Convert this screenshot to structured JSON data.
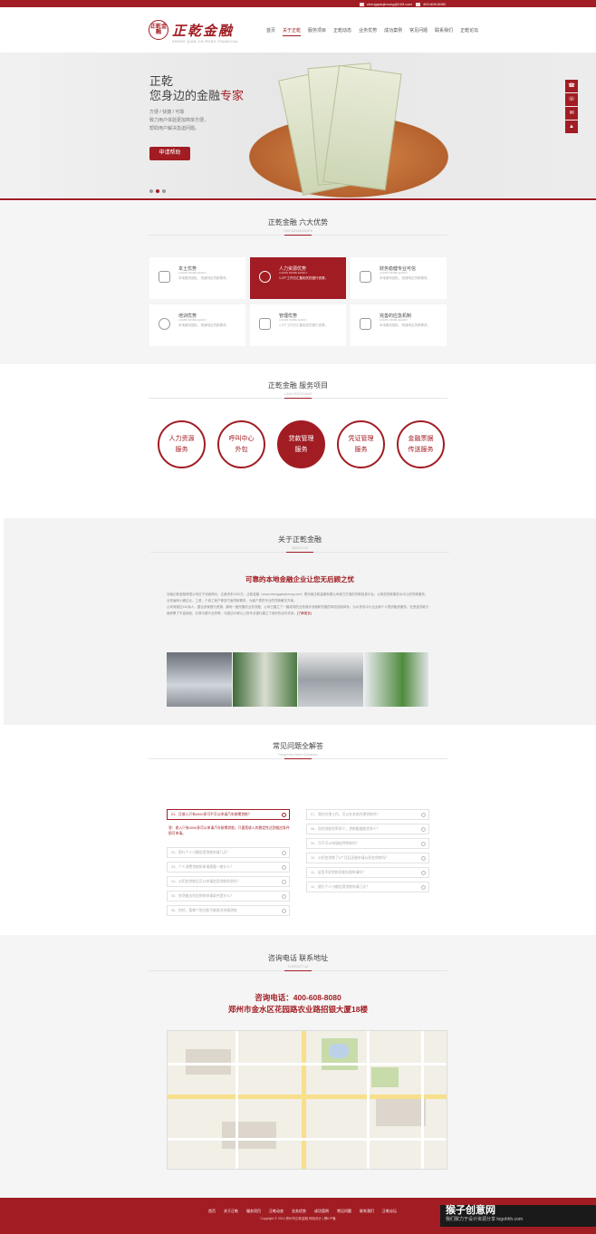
{
  "topbar": {
    "email": "zhengqianjinrong@163.com",
    "phone": "400-608-8080"
  },
  "logo": {
    "seal": "正乾金融",
    "name": "正乾金融",
    "sub": "ZHENG QIAN JIN RONG FINANCIAL"
  },
  "nav": [
    "首页",
    "关于正乾",
    "服务项目",
    "正乾动态",
    "业务优势",
    "成功案例",
    "常见问题",
    "联系我们",
    "正乾论坛"
  ],
  "hero": {
    "line1": "正乾",
    "line2_pre": "您身边的金融",
    "line2_em": "专家",
    "sub1": "方便 / 快捷 / 可靠",
    "sub2": "致力用户体验更加简单方便，",
    "sub3": "帮助用户解决急迫问题。",
    "button": "申请帮助"
  },
  "side": [
    "☎",
    "☏",
    "✉",
    "▲"
  ],
  "advantages": {
    "title": "正乾金融  六大优势",
    "en": "OUR ADVANTAGES",
    "cards": [
      {
        "t": "本土优势",
        "e": "LOANS MORE EASILY",
        "d": "本地服务团队，快速响应贷款需求。"
      },
      {
        "t": "人力资源优势",
        "e": "LOANS MORE EASILY",
        "d": "1-3个工作日汇集相关的银行资源，"
      },
      {
        "t": "财务稳健专业可信",
        "e": "LOANS MORE EASILY",
        "d": "本地服务团队，快速响应贷款需求。"
      },
      {
        "t": "培训优势",
        "e": "LOANS MORE EASILY",
        "d": "本地服务团队，快速响应贷款需求。"
      },
      {
        "t": "管理优势",
        "e": "LOANS MORE EASILY",
        "d": "1-3个工作日汇集相关的银行资源，"
      },
      {
        "t": "完善的应急机制",
        "e": "LOANS MORE EASILY",
        "d": "本地服务团队，快速响应贷款需求。"
      }
    ]
  },
  "services": {
    "title": "正乾金融  服务项目",
    "en": "LOAN PROGRAMS",
    "items": [
      {
        "l1": "人力资源",
        "l2": "服务"
      },
      {
        "l1": "呼叫中心",
        "l2": "外包"
      },
      {
        "l1": "贷款管理",
        "l2": "服务"
      },
      {
        "l1": "凭证管理",
        "l2": "服务"
      },
      {
        "l1": "金融票据",
        "l2": "传送服务"
      }
    ]
  },
  "about": {
    "title": "关于正乾金融",
    "en": "ABOUT US",
    "headline": "可靠的本地金融企业让您无后顾之忧",
    "p1": "河南正乾金融有限公司位于河南郑州，注册资本1000万，正乾金融（www.zhengqianjinrong.com）是河南正乾金融有限公司倾力打造的贷款信息平台，以规范贷款服务为中心的贷款服务。业务遍布小微企业、工资、个体工商户等多方面贷款需求，为客户提供专业的贷款解决方案。",
    "p2": "公司有超过100余人，整合多家银行资源，拥有一套完善的业务流程，公司已建立了一套成熟的业务操作流程和完善的风险控制体系，为众多的中小企业和个人提供融资服务，在资金贷款方面积累了丰富经验，计算与银行业务等，与超过30家以上的专业银行建立了良好的合作关系。",
    "more": "[了解更多]"
  },
  "faq": {
    "title": "常见问题全解答",
    "en": "Frequently Asked Questions",
    "left": [
      "01、月收入只有4000多可不可以申请汽车按揭贷款？",
      "02、银行个人小额信用贷款申请几天？",
      "03、个人消费贷款和申请需要一套什么？",
      "04、公积金贷款后可以申请信用贷款利息吗？",
      "05、房贷能出利信贷款申请条件是什么？",
      "06、你好，我哪个地方能不能再次申请贷款"
    ],
    "answer": "答：收入只有4000多可以申请汽车按揭贷款，只要您收入的稳定性达到相应条件即可申请。",
    "right": [
      "07、我在外地工作，可以在本地办理贷款吗？",
      "08、现在贷款利率多少，贷款额度能贷多少？",
      "09、可不可以申请抵押贷款吗？",
      "10、公积金贷款了5个月后还能申请公积金贷款吗？",
      "11、征信不好贷款还能办理申请吗？",
      "12、银行个人小额信用贷款申请几天？"
    ]
  },
  "contact": {
    "title": "咨询电话  联系地址",
    "en": "CONTACT US",
    "phone": "咨询电话：400-608-8080",
    "address": "郑州市金水区花园路农业路招银大厦18楼"
  },
  "footer": {
    "nav": [
      "首页",
      "关于正乾",
      "服务项目",
      "正乾动态",
      "业务优势",
      "成功案例",
      "常见问题",
      "联系我们",
      "正乾论坛"
    ],
    "copy": "Copyright © 2014 郑州市正乾金融 网站设计 | 豫ICP备",
    "wm": "猴子创意网",
    "wm_sub": "我们致力于设计资源分享 logohhh.com"
  }
}
